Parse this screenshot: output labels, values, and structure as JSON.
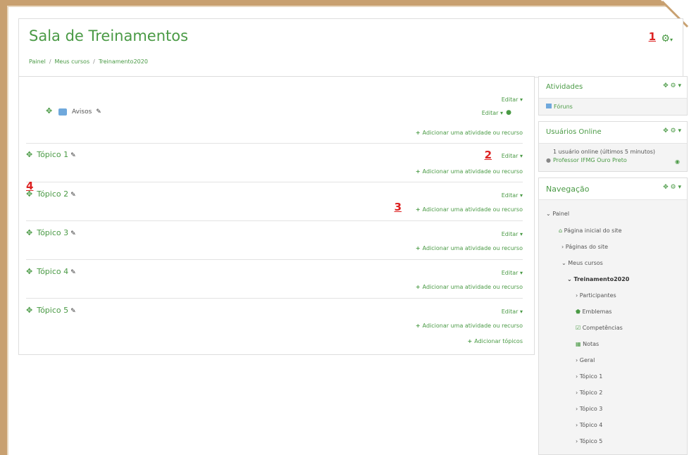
{
  "course": {
    "title": "Sala de Treinamentos",
    "breadcrumb": [
      "Painel",
      "Meus cursos",
      "Treinamento2020"
    ]
  },
  "markers": [
    "1",
    "2",
    "3",
    "4"
  ],
  "sections": {
    "avisos": {
      "label": "Avisos",
      "edit_label": "Editar ▾",
      "item_edit_label": "Editar ▾",
      "add_label": "Adicionar uma atividade ou recurso"
    },
    "topics": [
      {
        "title": "Tópico 1",
        "edit_label": "Editar ▾",
        "add_label": "Adicionar uma atividade ou recurso"
      },
      {
        "title": "Tópico 2",
        "edit_label": "Editar ▾",
        "add_label": "Adicionar uma atividade ou recurso"
      },
      {
        "title": "Tópico 3",
        "edit_label": "Editar ▾",
        "add_label": "Adicionar uma atividade ou recurso"
      },
      {
        "title": "Tópico 4",
        "edit_label": "Editar ▾",
        "add_label": "Adicionar uma atividade ou recurso"
      },
      {
        "title": "Tópico 5",
        "edit_label": "Editar ▾",
        "add_label": "Adicionar uma atividade ou recurso"
      }
    ],
    "add_topics_label": "Adicionar tópicos"
  },
  "blocks": {
    "atividades": {
      "title": "Atividades",
      "items": [
        "Fóruns"
      ]
    },
    "usuarios_online": {
      "title": "Usuários Online",
      "summary": "1 usuário online (últimos 5 minutos)",
      "user": "Professor IFMG Ouro Preto"
    },
    "navegacao": {
      "title": "Navegação",
      "items": [
        "Painel",
        "Página inicial do site",
        "Páginas do site",
        "Meus cursos",
        "Treinamento2020",
        "Participantes",
        "Emblemas",
        "Competências",
        "Notas",
        "Geral",
        "Tópico 1",
        "Tópico 2",
        "Tópico 3",
        "Tópico 4",
        "Tópico 5"
      ]
    }
  },
  "colors": {
    "accent": "#4a9a45",
    "marker": "#dd2222",
    "frame": "#c8a070"
  }
}
